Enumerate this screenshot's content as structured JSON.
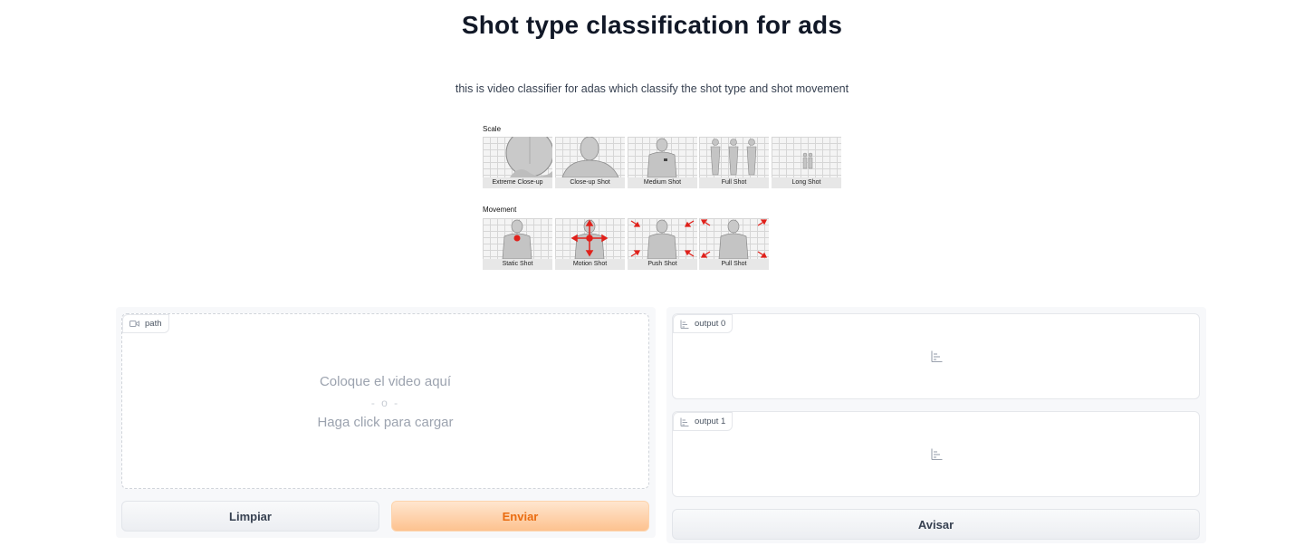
{
  "page": {
    "title": "Shot type classification for ads",
    "description": "this is video classifier for adas which classify the shot type and shot movement"
  },
  "illustration": {
    "scale_label": "Scale",
    "movement_label": "Movement",
    "scale_items": [
      "Extreme Close-up",
      "Close-up Shot",
      "Medium Shot",
      "Full Shot",
      "Long Shot"
    ],
    "movement_items": [
      "Static Shot",
      "Motion Shot",
      "Push Shot",
      "Pull Shot"
    ]
  },
  "input": {
    "label": "path",
    "icon": "video-icon",
    "drop_line1": "Coloque el video aquí",
    "drop_or": "- o -",
    "drop_line2": "Haga click para cargar"
  },
  "buttons": {
    "clear": "Limpiar",
    "submit": "Enviar",
    "flag": "Avisar"
  },
  "outputs": [
    {
      "label": "output 0",
      "icon": "label-chart-icon"
    },
    {
      "label": "output 1",
      "icon": "label-chart-icon"
    }
  ],
  "colors": {
    "primary_text": "#ea6c10",
    "primary_bg": "#fdc28f",
    "arrow_red": "#e0211b"
  }
}
